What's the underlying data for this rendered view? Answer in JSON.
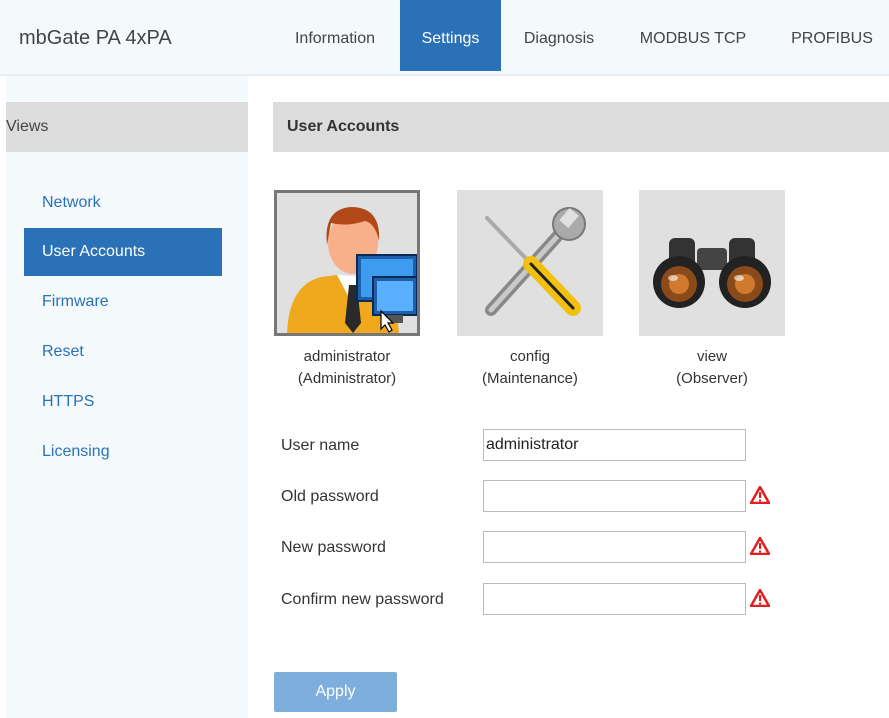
{
  "app": {
    "title": "mbGate PA 4xPA"
  },
  "tabs": [
    {
      "label": "Information"
    },
    {
      "label": "Settings"
    },
    {
      "label": "Diagnosis"
    },
    {
      "label": "MODBUS TCP"
    },
    {
      "label": "PROFIBUS"
    }
  ],
  "sidebar": {
    "heading": "Views",
    "items": [
      {
        "label": "Network"
      },
      {
        "label": "User Accounts"
      },
      {
        "label": "Firmware"
      },
      {
        "label": "Reset"
      },
      {
        "label": "HTTPS"
      },
      {
        "label": "Licensing"
      }
    ]
  },
  "content": {
    "heading": "User Accounts",
    "accounts": [
      {
        "name": "administrator",
        "role": "(Administrator)",
        "icon": "administrator-icon"
      },
      {
        "name": "config",
        "role": "(Maintenance)",
        "icon": "tools-icon"
      },
      {
        "name": "view",
        "role": "(Observer)",
        "icon": "binoculars-icon"
      }
    ],
    "form": {
      "user_name_label": "User name",
      "user_name_value": "administrator",
      "old_password_label": "Old password",
      "new_password_label": "New password",
      "confirm_password_label": "Confirm new password"
    },
    "apply_label": "Apply"
  },
  "colors": {
    "accent": "#2a71b8",
    "apply_button": "#7eaedc",
    "warning": "#e02020"
  }
}
